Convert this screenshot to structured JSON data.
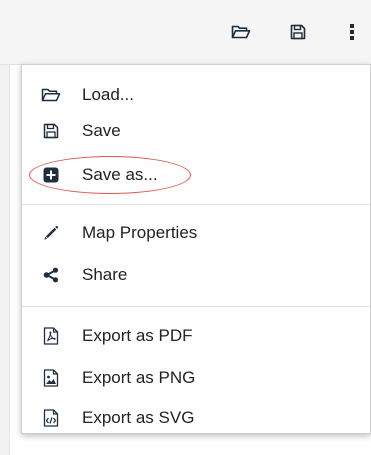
{
  "toolbar": {
    "buttons": [
      {
        "icon": "folder-open-icon"
      },
      {
        "icon": "floppy-disk-icon"
      },
      {
        "icon": "vertical-dots-icon"
      }
    ]
  },
  "menu": {
    "items": [
      {
        "label": "Load...",
        "icon": "folder-open-icon"
      },
      {
        "label": "Save",
        "icon": "floppy-disk-icon"
      },
      {
        "label": "Save as...",
        "icon": "plus-square-icon",
        "highlighted": true
      },
      {
        "label": "Map Properties",
        "icon": "pencil-icon"
      },
      {
        "label": "Share",
        "icon": "share-icon"
      },
      {
        "label": "Export as PDF",
        "icon": "pdf-file-icon"
      },
      {
        "label": "Export as PNG",
        "icon": "image-file-icon"
      },
      {
        "label": "Export as SVG",
        "icon": "code-file-icon"
      }
    ]
  },
  "colors": {
    "highlight_ring": "#e0564a",
    "icon": "#1f2d3d",
    "text": "#222222"
  }
}
